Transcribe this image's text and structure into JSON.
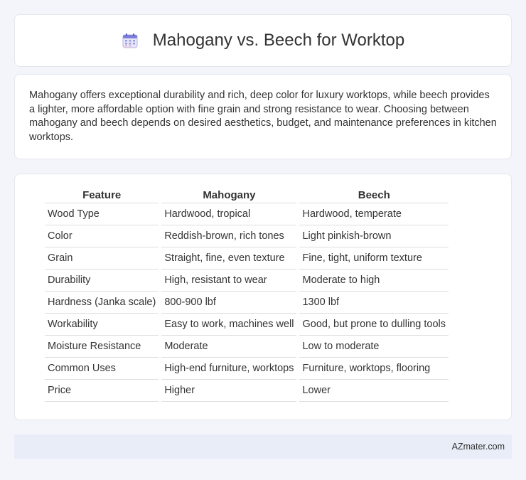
{
  "header": {
    "title": "Mahogany vs. Beech for Worktop",
    "icon": "calendar-icon"
  },
  "description": "Mahogany offers exceptional durability and rich, deep color for luxury worktops, while beech provides a lighter, more affordable option with fine grain and strong resistance to wear. Choosing between mahogany and beech depends on desired aesthetics, budget, and maintenance preferences in kitchen worktops.",
  "table": {
    "headers": [
      "Feature",
      "Mahogany",
      "Beech"
    ],
    "rows": [
      [
        "Wood Type",
        "Hardwood, tropical",
        "Hardwood, temperate"
      ],
      [
        "Color",
        "Reddish-brown, rich tones",
        "Light pinkish-brown"
      ],
      [
        "Grain",
        "Straight, fine, even texture",
        "Fine, tight, uniform texture"
      ],
      [
        "Durability",
        "High, resistant to wear",
        "Moderate to high"
      ],
      [
        "Hardness (Janka scale)",
        "800-900 lbf",
        "1300 lbf"
      ],
      [
        "Workability",
        "Easy to work, machines well",
        "Good, but prone to dulling tools"
      ],
      [
        "Moisture Resistance",
        "Moderate",
        "Low to moderate"
      ],
      [
        "Common Uses",
        "High-end furniture, worktops",
        "Furniture, worktops, flooring"
      ],
      [
        "Price",
        "Higher",
        "Lower"
      ]
    ]
  },
  "footer": {
    "brand": "AZmater.com"
  }
}
